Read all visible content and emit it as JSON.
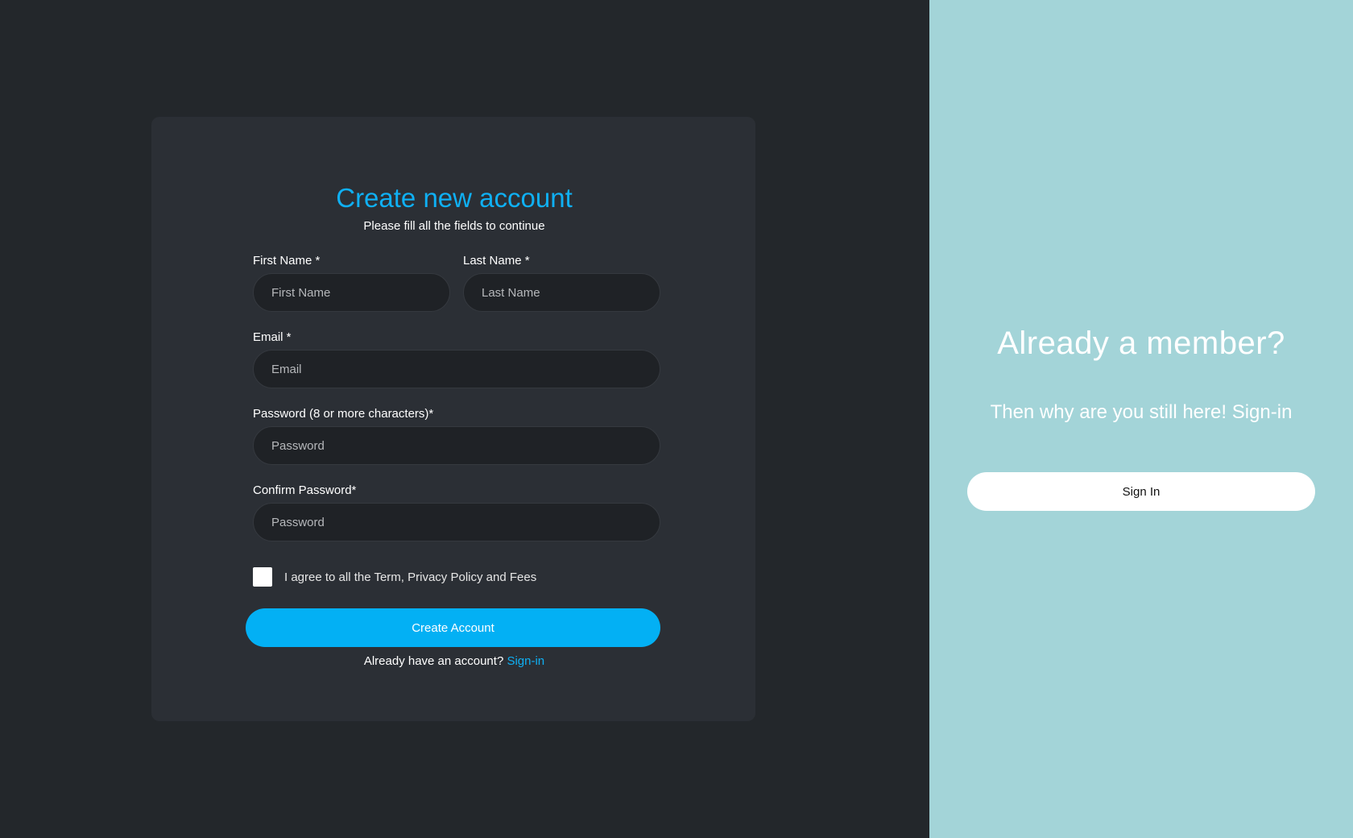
{
  "signup": {
    "title": "Create new account",
    "subtitle": "Please fill all the fields to continue",
    "first_name": {
      "label": "First Name *",
      "placeholder": "First Name",
      "value": ""
    },
    "last_name": {
      "label": "Last Name *",
      "placeholder": "Last Name",
      "value": ""
    },
    "email": {
      "label": "Email *",
      "placeholder": "Email",
      "value": ""
    },
    "password": {
      "label": "Password (8 or more characters)*",
      "placeholder": "Password",
      "value": ""
    },
    "confirm_password": {
      "label": "Confirm Password*",
      "placeholder": "Password",
      "value": ""
    },
    "agree_label": "I agree to all the Term, Privacy Policy and Fees",
    "agree_checked": false,
    "create_button": "Create Account",
    "have_account_text": "Already have an account?",
    "signin_link": "Sign-in"
  },
  "member_panel": {
    "title": "Already a member?",
    "subtitle": "Then why are you still here! Sign-in",
    "signin_button": "Sign In"
  },
  "colors": {
    "left_background": "#23272b",
    "card_background": "#2b2f35",
    "input_background": "#1f2226",
    "accent": "#03b0f4",
    "right_background": "#a3d4d8"
  }
}
